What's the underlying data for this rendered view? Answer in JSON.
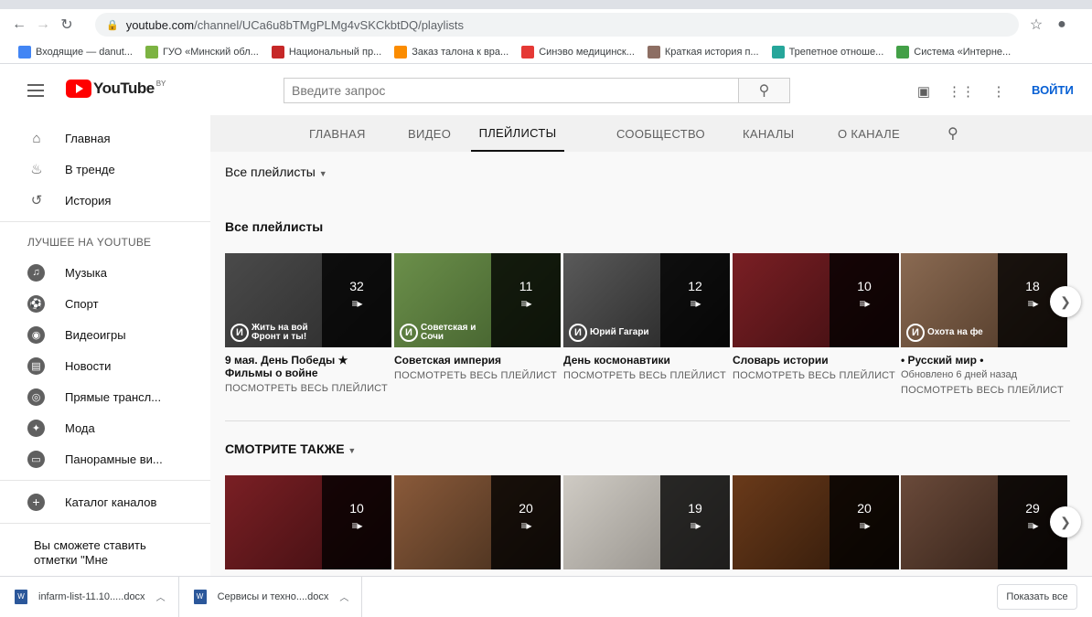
{
  "browser": {
    "url_host": "youtube.com",
    "url_path": "/channel/UCa6u8bTMgPLMg4vSKCkbtDQ/playlists",
    "bookmarks": [
      {
        "label": "Входящие — danut...",
        "color": "#4285f4"
      },
      {
        "label": "ГУО «Минский обл...",
        "color": "#7cb342"
      },
      {
        "label": "Национальный пр...",
        "color": "#c62828"
      },
      {
        "label": "Заказ талона к вра...",
        "color": "#fb8c00"
      },
      {
        "label": "Синэво медицинск...",
        "color": "#e53935"
      },
      {
        "label": "Краткая история п...",
        "color": "#8d6e63"
      },
      {
        "label": "Трепетное отноше...",
        "color": "#26a69a"
      },
      {
        "label": "Система «Интерне...",
        "color": "#43a047"
      }
    ]
  },
  "header": {
    "logo_text": "YouTube",
    "logo_country": "BY",
    "search_placeholder": "Введите запрос",
    "signin_label": "ВОЙТИ"
  },
  "sidebar": {
    "main_items": [
      {
        "label": "Главная",
        "icon": "home-icon",
        "glyph": "⌂"
      },
      {
        "label": "В тренде",
        "icon": "flame-icon",
        "glyph": "♨"
      },
      {
        "label": "История",
        "icon": "history-icon",
        "glyph": "↺"
      }
    ],
    "section_title": "ЛУЧШЕЕ НА YOUTUBE",
    "best_items": [
      {
        "label": "Музыка",
        "icon": "music-icon",
        "glyph": "♫"
      },
      {
        "label": "Спорт",
        "icon": "sport-icon",
        "glyph": "⚽"
      },
      {
        "label": "Видеоигры",
        "icon": "gamepad-icon",
        "glyph": "◉"
      },
      {
        "label": "Новости",
        "icon": "news-icon",
        "glyph": "▤"
      },
      {
        "label": "Прямые трансл...",
        "icon": "live-icon",
        "glyph": "◎"
      },
      {
        "label": "Мода",
        "icon": "fashion-icon",
        "glyph": "✦"
      },
      {
        "label": "Панорамные ви...",
        "icon": "panorama-icon",
        "glyph": "▭"
      }
    ],
    "catalog_label": "Каталог каналов",
    "note": "Вы сможете ставить отметки \"Мне"
  },
  "tabs": [
    {
      "label": "ГЛАВНАЯ",
      "active": false
    },
    {
      "label": "ВИДЕО",
      "active": false
    },
    {
      "label": "ПЛЕЙЛИСТЫ",
      "active": true
    },
    {
      "label": "СООБЩЕСТВО",
      "active": false
    },
    {
      "label": "КАНАЛЫ",
      "active": false
    },
    {
      "label": "О КАНАЛЕ",
      "active": false
    }
  ],
  "filter_label": "Все плейлисты",
  "section1": {
    "title": "Все плейлисты",
    "cards": [
      {
        "count": "32",
        "cap1": "Жить на вой",
        "cap2": "Фронт и ты!",
        "title": "9 мая. День Победы ★ Фильмы о войне",
        "meta": "",
        "link": "ПОСМОТРЕТЬ ВЕСЬ ПЛЕЙЛИСТ",
        "bg": "#4a4a4a",
        "bg2": "#2a2a2a"
      },
      {
        "count": "11",
        "cap1": "Советская и",
        "cap2": "Сочи",
        "title": "Советская империя",
        "meta": "",
        "link": "ПОСМОТРЕТЬ ВЕСЬ ПЛЕЙЛИСТ",
        "bg": "#6b8f4a",
        "bg2": "#3e5a2a"
      },
      {
        "count": "12",
        "cap1": "Юрий Гагари",
        "cap2": "",
        "title": "День космонавтики",
        "meta": "",
        "link": "ПОСМОТРЕТЬ ВЕСЬ ПЛЕЙЛИСТ",
        "bg": "#5a5a5a",
        "bg2": "#1f1f1f"
      },
      {
        "count": "10",
        "cap1": "",
        "cap2": "",
        "title": "Словарь истории",
        "meta": "",
        "link": "ПОСМОТРЕТЬ ВЕСЬ ПЛЕЙЛИСТ",
        "bg": "#7a1f24",
        "bg2": "#3a0d10"
      },
      {
        "count": "18",
        "cap1": "Охота на фе",
        "cap2": "",
        "title": "• Русский мир •",
        "meta": "Обновлено 6 дней назад",
        "link": "ПОСМОТРЕТЬ ВЕСЬ ПЛЕЙЛИСТ",
        "bg": "#8a6a52",
        "bg2": "#4a3424"
      }
    ]
  },
  "section2": {
    "title": "СМОТРИТЕ ТАКЖЕ",
    "cards": [
      {
        "count": "10",
        "bg": "#7a1f24",
        "bg2": "#3a0d10"
      },
      {
        "count": "20",
        "bg": "#8a5a3a",
        "bg2": "#3e2a1a"
      },
      {
        "count": "19",
        "bg": "#cfcbc4",
        "bg2": "#8a8680"
      },
      {
        "count": "20",
        "bg": "#6a3a1a",
        "bg2": "#2a1608"
      },
      {
        "count": "29",
        "bg": "#6a4a3a",
        "bg2": "#2a1a12"
      }
    ]
  },
  "downloads": {
    "items": [
      "infarm-list-11.10.....docx",
      "Сервисы и техно....docx"
    ],
    "show_all": "Показать все"
  }
}
